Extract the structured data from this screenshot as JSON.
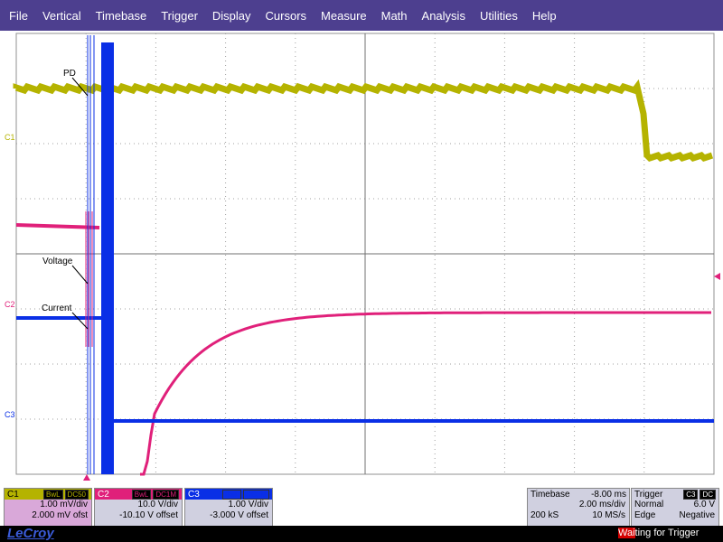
{
  "menu": [
    "File",
    "Vertical",
    "Timebase",
    "Trigger",
    "Display",
    "Cursors",
    "Measure",
    "Math",
    "Analysis",
    "Utilities",
    "Help"
  ],
  "channel_labels": {
    "c1": "C1",
    "c2": "C2",
    "c3": "C3"
  },
  "annotations": {
    "pd": "PD",
    "voltage": "Voltage",
    "current": "Current"
  },
  "colors": {
    "c1": "#b5b300",
    "c2": "#e0207a",
    "c3": "#0a2fe6",
    "menu_bg": "#4d3f8f"
  },
  "c1_box": {
    "name": "C1",
    "bwl": "BwL",
    "coupling": "DC50",
    "vdiv": "1.00 mV/div",
    "offset": "2.000 mV ofst"
  },
  "c2_box": {
    "name": "C2",
    "bwl": "BwL",
    "coupling": "DC1M",
    "vdiv": "10.0 V/div",
    "offset": "-10.10 V offset"
  },
  "c3_box": {
    "name": "C3",
    "bwl": "BwL",
    "coupling": "DC1M",
    "vdiv": "1.00 V/div",
    "offset": "-3.000 V offset"
  },
  "timebase": {
    "label": "Timebase",
    "delay": "-8.00 ms",
    "tdiv": "2.00 ms/div",
    "samples": "200 kS",
    "rate": "10 MS/s"
  },
  "trigger": {
    "label": "Trigger",
    "source": "C3",
    "coupling": "DC",
    "mode": "Normal",
    "level": "6.0 V",
    "type": "Edge",
    "slope": "Negative"
  },
  "brand": "LeCroy",
  "status": {
    "prefix": "Wai",
    "rest": "ting for Trigger"
  }
}
